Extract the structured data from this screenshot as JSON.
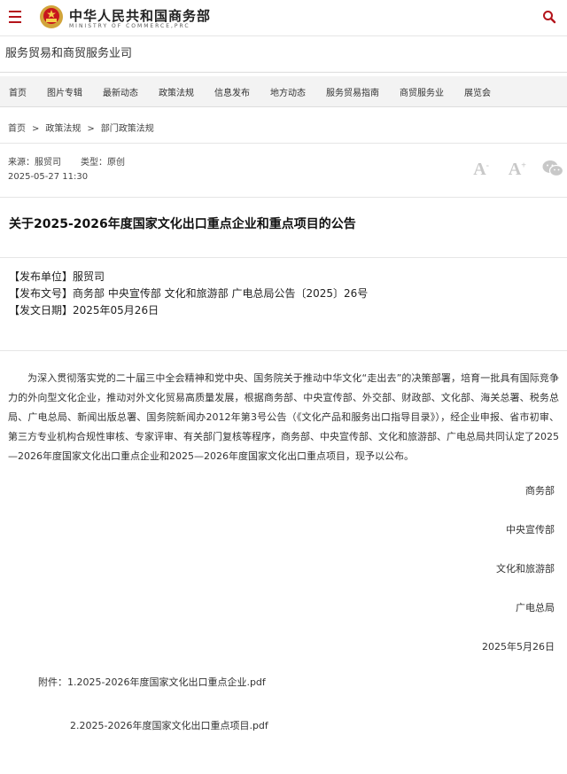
{
  "header": {
    "logo_cn": "中华人民共和国商务部",
    "logo_en": "MINISTRY OF COMMERCE,PRC",
    "brand_color": "#b4141b"
  },
  "department": "服务贸易和商贸服务业司",
  "nav": [
    "首页",
    "图片专辑",
    "最新动态",
    "政策法规",
    "信息发布",
    "地方动态",
    "服务贸易指南",
    "商贸服务业",
    "展览会"
  ],
  "breadcrumb": [
    "首页",
    "政策法规",
    "部门政策法规"
  ],
  "breadcrumb_separator": ">",
  "meta": {
    "source": "来源：服贸司",
    "type": "类型：原创",
    "date": "2025-05-27 11:30",
    "font_large": "A",
    "font_small": "A"
  },
  "article": {
    "title": "关于2025-2026年度国家文化出口重点企业和重点项目的公告",
    "info": [
      "【发布单位】服贸司",
      "【发布文号】商务部 中央宣传部 文化和旅游部 广电总局公告〔2025〕26号",
      "【发文日期】2025年05月26日"
    ],
    "body": "为深入贯彻落实党的二十届三中全会精神和党中央、国务院关于推动中华文化“走出去”的决策部署，培育一批具有国际竞争力的外向型文化企业，推动对外文化贸易高质量发展，根据商务部、中央宣传部、外交部、财政部、文化部、海关总署、税务总局、广电总局、新闻出版总署、国务院新闻办2012年第3号公告（《文化产品和服务出口指导目录》），经企业申报、省市初审、第三方专业机构合规性审核、专家评审、有关部门复核等程序，商务部、中央宣传部、文化和旅游部、广电总局共同认定了2025—2026年度国家文化出口重点企业和2025—2026年度国家文化出口重点项目，现予以公布。",
    "signatures": [
      "商务部",
      "中央宣传部",
      "文化和旅游部",
      "广电总局",
      "2025年5月26日"
    ],
    "attachments_label": "附件：",
    "attachments": [
      "1.2025-2026年度国家文化出口重点企业.pdf",
      "2.2025-2026年度国家文化出口重点项目.pdf"
    ]
  }
}
